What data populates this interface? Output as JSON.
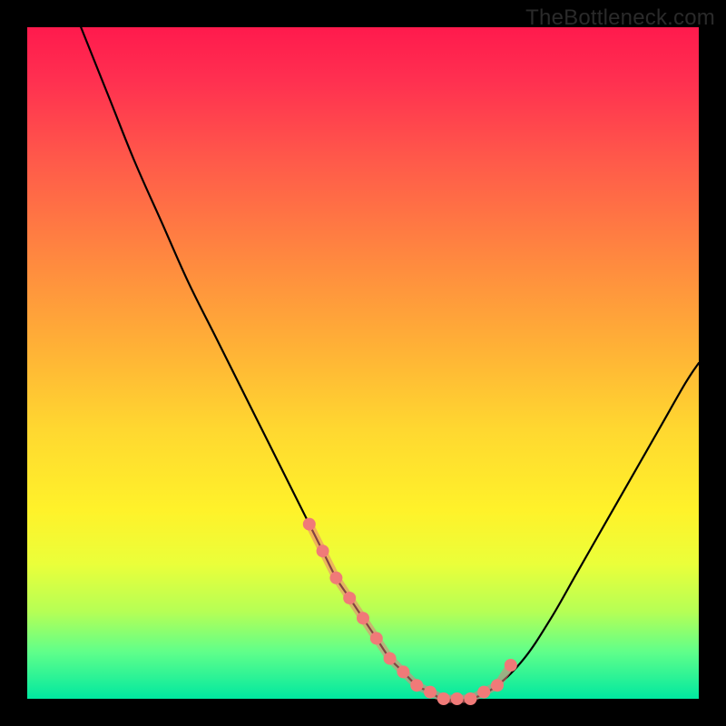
{
  "watermark": "TheBottleneck.com",
  "chart_data": {
    "type": "line",
    "title": "",
    "xlabel": "",
    "ylabel": "",
    "xlim": [
      0,
      100
    ],
    "ylim": [
      0,
      100
    ],
    "series": [
      {
        "name": "curve",
        "color": "#000000",
        "x": [
          8,
          12,
          16,
          20,
          24,
          28,
          32,
          36,
          40,
          42,
          44,
          46,
          48,
          50,
          52,
          54,
          56,
          58,
          60,
          62,
          66,
          70,
          74,
          78,
          82,
          86,
          90,
          94,
          98,
          100
        ],
        "values": [
          100,
          90,
          80,
          71,
          62,
          54,
          46,
          38,
          30,
          26,
          22,
          18,
          15,
          12,
          9,
          6,
          4,
          2,
          1,
          0,
          0,
          2,
          6,
          12,
          19,
          26,
          33,
          40,
          47,
          50
        ]
      },
      {
        "name": "markers",
        "color": "#f07a78",
        "x": [
          42,
          44,
          46,
          48,
          50,
          52,
          54,
          56,
          58,
          60,
          62,
          64,
          66,
          68,
          70,
          72
        ],
        "values": [
          26,
          22,
          18,
          15,
          12,
          9,
          6,
          4,
          2,
          1,
          0,
          0,
          0,
          1,
          2,
          5
        ]
      }
    ],
    "gradient_bands": [
      {
        "name": "red",
        "approx_y_range": [
          70,
          100
        ]
      },
      {
        "name": "orange",
        "approx_y_range": [
          45,
          70
        ]
      },
      {
        "name": "yellow",
        "approx_y_range": [
          15,
          45
        ]
      },
      {
        "name": "green",
        "approx_y_range": [
          0,
          15
        ]
      }
    ]
  }
}
